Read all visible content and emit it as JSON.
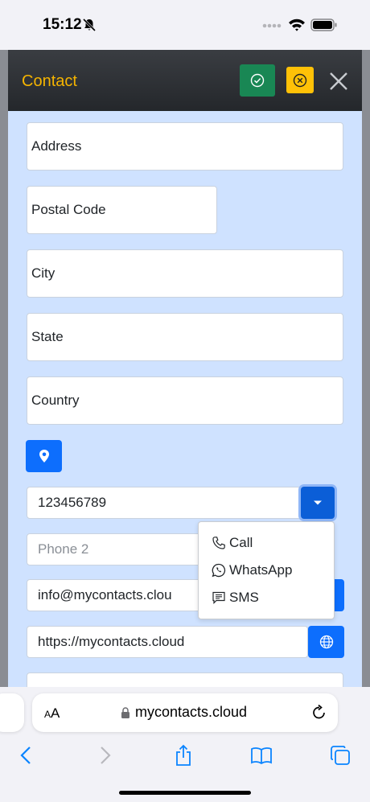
{
  "status": {
    "time": "15:12"
  },
  "modal": {
    "title": "Contact",
    "title_color": "#f5b400",
    "save_icon": "check-circle-icon",
    "cancel_icon": "x-circle-icon",
    "close_icon": "close-icon"
  },
  "form": {
    "address_placeholder": "Address",
    "postal_code_placeholder": "Postal Code",
    "city_placeholder": "City",
    "state_placeholder": "State",
    "country_placeholder": "Country",
    "phone1_value": "123456789",
    "phone2_placeholder": "Phone 2",
    "email_value": "info@mycontacts.clou",
    "website_value": "https://mycontacts.cloud"
  },
  "phone_menu": {
    "items": [
      {
        "label": "Call",
        "icon": "phone-icon"
      },
      {
        "label": "WhatsApp",
        "icon": "whatsapp-icon"
      },
      {
        "label": "SMS",
        "icon": "sms-icon"
      }
    ]
  },
  "browser": {
    "aa_small": "A",
    "aa_large": "A",
    "url": "mycontacts.cloud"
  },
  "colors": {
    "body_bg": "#cfe2ff",
    "primary": "#0d6efd",
    "success": "#198754",
    "warning": "#ffc107"
  }
}
